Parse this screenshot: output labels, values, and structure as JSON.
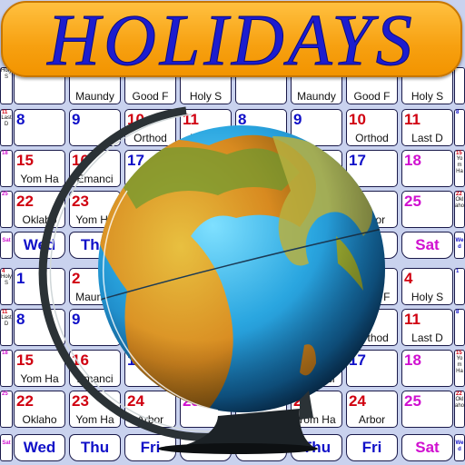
{
  "banner": {
    "title": "HOLIDAYS"
  },
  "colors": {
    "weekday": "#1010c8",
    "holiday": "#d00010",
    "saturday": "#d010d0",
    "banner": "#f7a010",
    "title": "#1c1ccf"
  },
  "calendar": {
    "columns": [
      "Sat",
      "Wed",
      "Thu",
      "Fri",
      "Sat",
      "Wed",
      "Thu",
      "Fri",
      "Sat",
      "Wed"
    ],
    "blocks": [
      {
        "rows": [
          [
            {
              "l": "Holy S"
            },
            {
              "l": ""
            },
            {
              "l": "Maundy"
            },
            {
              "l": "Good F"
            },
            {
              "l": "Holy S"
            },
            {
              "l": ""
            },
            {
              "l": "Maundy"
            },
            {
              "l": "Good F"
            },
            {
              "l": "Holy S"
            },
            {
              "l": ""
            }
          ],
          [
            {
              "n": "11",
              "l": "Last D",
              "c": "holiday"
            },
            {
              "n": "8",
              "l": "",
              "c": "weekday"
            },
            {
              "n": "9",
              "l": "",
              "c": "weekday"
            },
            {
              "n": "10",
              "l": "Orthod",
              "c": "holiday"
            },
            {
              "n": "11",
              "l": "Last D",
              "c": "holiday"
            },
            {
              "n": "8",
              "l": "",
              "c": "weekday"
            },
            {
              "n": "9",
              "l": "",
              "c": "weekday"
            },
            {
              "n": "10",
              "l": "Orthod",
              "c": "holiday"
            },
            {
              "n": "11",
              "l": "Last D",
              "c": "holiday"
            },
            {
              "n": "8",
              "l": "",
              "c": "weekday"
            }
          ],
          [
            {
              "n": "18",
              "l": "",
              "c": "saturday"
            },
            {
              "n": "15",
              "l": "Yom Ha",
              "c": "holiday"
            },
            {
              "n": "16",
              "l": "Emanci",
              "c": "holiday"
            },
            {
              "n": "17",
              "l": "",
              "c": "weekday"
            },
            {
              "n": "18",
              "l": "",
              "c": "saturday"
            },
            {
              "n": "15",
              "l": "Yom Ha",
              "c": "holiday"
            },
            {
              "n": "16",
              "l": "Emanci",
              "c": "holiday"
            },
            {
              "n": "17",
              "l": "",
              "c": "weekday"
            },
            {
              "n": "18",
              "l": "",
              "c": "saturday"
            },
            {
              "n": "15",
              "l": "Yom Ha",
              "c": "holiday"
            }
          ],
          [
            {
              "n": "25",
              "l": "",
              "c": "saturday"
            },
            {
              "n": "22",
              "l": "Oklaho",
              "c": "holiday"
            },
            {
              "n": "23",
              "l": "Yom Ha",
              "c": "holiday"
            },
            {
              "n": "24",
              "l": "Arbor",
              "c": "holiday"
            },
            {
              "n": "25",
              "l": "",
              "c": "saturday"
            },
            {
              "n": "22",
              "l": "Oklaho",
              "c": "holiday"
            },
            {
              "n": "23",
              "l": "Yom Ha",
              "c": "holiday"
            },
            {
              "n": "24",
              "l": "Arbor",
              "c": "holiday"
            },
            {
              "n": "25",
              "l": "",
              "c": "saturday"
            },
            {
              "n": "22",
              "l": "Oklaho",
              "c": "holiday"
            }
          ]
        ]
      },
      {
        "rows": [
          [
            {
              "n": "4",
              "l": "Holy S",
              "c": "holiday"
            },
            {
              "n": "1",
              "l": "",
              "c": "weekday"
            },
            {
              "n": "2",
              "l": "Maundy",
              "c": "holiday"
            },
            {
              "n": "3",
              "l": "Good F",
              "c": "holiday"
            },
            {
              "n": "4",
              "l": "Holy S",
              "c": "holiday"
            },
            {
              "n": "1",
              "l": "",
              "c": "weekday"
            },
            {
              "n": "2",
              "l": "Maundy",
              "c": "holiday"
            },
            {
              "n": "3",
              "l": "Good F",
              "c": "holiday"
            },
            {
              "n": "4",
              "l": "Holy S",
              "c": "holiday"
            },
            {
              "n": "1",
              "l": "",
              "c": "weekday"
            }
          ],
          [
            {
              "n": "11",
              "l": "Last D",
              "c": "holiday"
            },
            {
              "n": "8",
              "l": "",
              "c": "weekday"
            },
            {
              "n": "9",
              "l": "",
              "c": "weekday"
            },
            {
              "n": "10",
              "l": "Orthod",
              "c": "holiday"
            },
            {
              "n": "11",
              "l": "Last D",
              "c": "holiday"
            },
            {
              "n": "8",
              "l": "",
              "c": "weekday"
            },
            {
              "n": "9",
              "l": "",
              "c": "weekday"
            },
            {
              "n": "10",
              "l": "Orthod",
              "c": "holiday"
            },
            {
              "n": "11",
              "l": "Last D",
              "c": "holiday"
            },
            {
              "n": "8",
              "l": "",
              "c": "weekday"
            }
          ],
          [
            {
              "n": "18",
              "l": "",
              "c": "saturday"
            },
            {
              "n": "15",
              "l": "Yom Ha",
              "c": "holiday"
            },
            {
              "n": "16",
              "l": "Emanci",
              "c": "holiday"
            },
            {
              "n": "17",
              "l": "",
              "c": "weekday"
            },
            {
              "n": "18",
              "l": "",
              "c": "saturday"
            },
            {
              "n": "15",
              "l": "Yom Ha",
              "c": "holiday"
            },
            {
              "n": "16",
              "l": "Emanci",
              "c": "holiday"
            },
            {
              "n": "17",
              "l": "",
              "c": "weekday"
            },
            {
              "n": "18",
              "l": "",
              "c": "saturday"
            },
            {
              "n": "15",
              "l": "Yom Ha",
              "c": "holiday"
            }
          ],
          [
            {
              "n": "25",
              "l": "",
              "c": "saturday"
            },
            {
              "n": "22",
              "l": "Oklaho",
              "c": "holiday"
            },
            {
              "n": "23",
              "l": "Yom Ha",
              "c": "holiday"
            },
            {
              "n": "24",
              "l": "Arbor",
              "c": "holiday"
            },
            {
              "n": "25",
              "l": "",
              "c": "saturday"
            },
            {
              "n": "22",
              "l": "Oklaho",
              "c": "holiday"
            },
            {
              "n": "23",
              "l": "Yom Ha",
              "c": "holiday"
            },
            {
              "n": "24",
              "l": "Arbor",
              "c": "holiday"
            },
            {
              "n": "25",
              "l": "",
              "c": "saturday"
            },
            {
              "n": "22",
              "l": "Oklaho",
              "c": "holiday"
            }
          ]
        ]
      }
    ]
  },
  "icons": {
    "globe": "globe-icon"
  }
}
